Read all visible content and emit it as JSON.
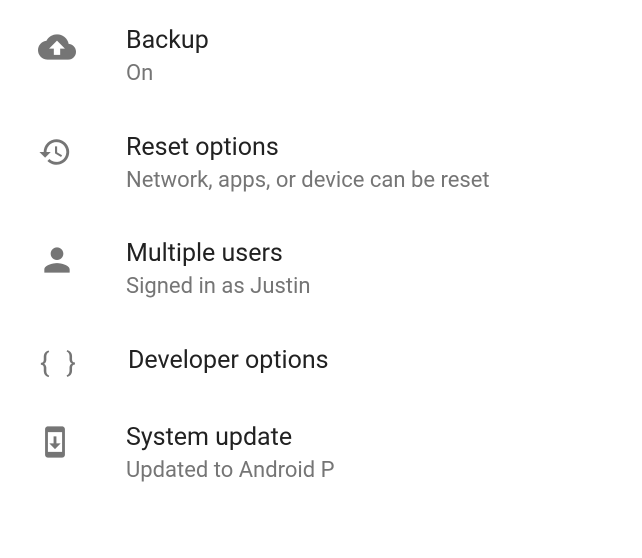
{
  "items": [
    {
      "title": "Backup",
      "subtitle": "On"
    },
    {
      "title": "Reset options",
      "subtitle": "Network, apps, or device can be reset"
    },
    {
      "title": "Multiple users",
      "subtitle": "Signed in as Justin"
    },
    {
      "title": "Developer options",
      "subtitle": ""
    },
    {
      "title": "System update",
      "subtitle": "Updated to Android P"
    }
  ]
}
